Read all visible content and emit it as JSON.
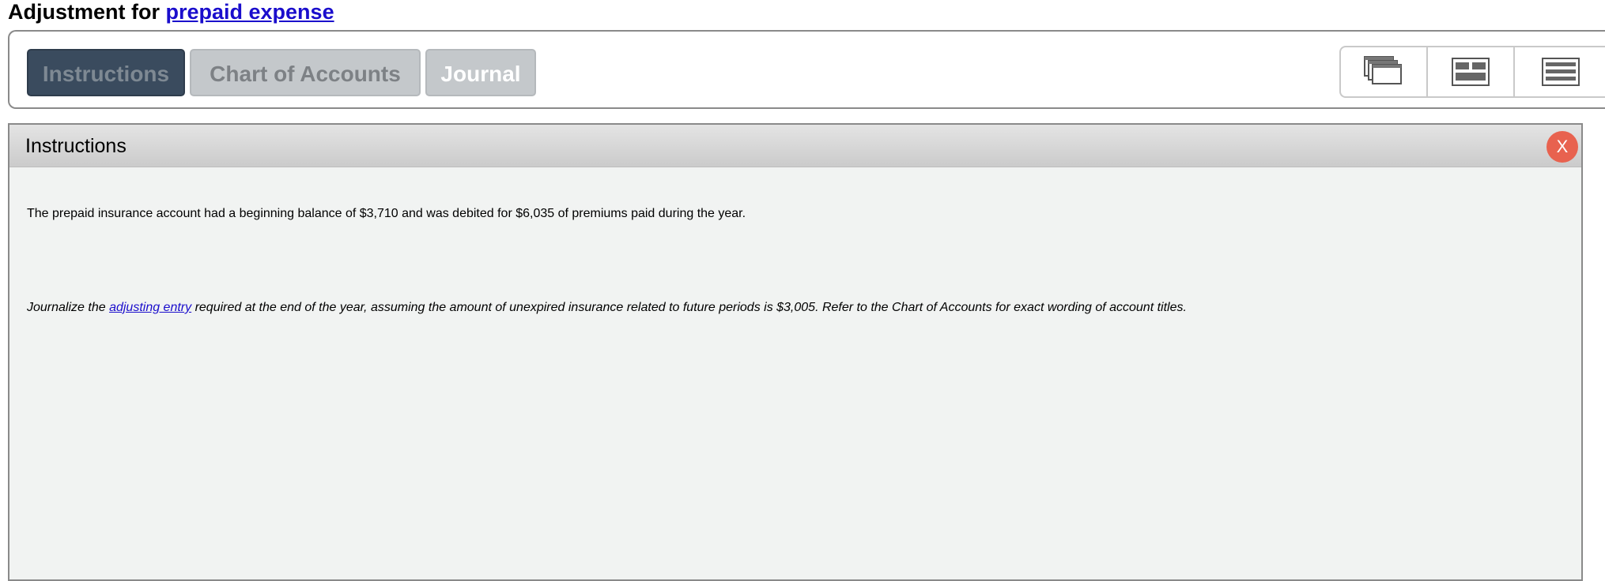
{
  "title": {
    "prefix": "Adjustment for ",
    "link": "prepaid expense"
  },
  "tabs": [
    {
      "label": "Instructions",
      "state": "active"
    },
    {
      "label": "Chart of Accounts",
      "state": "inactive"
    },
    {
      "label": "Journal",
      "state": "inactive"
    }
  ],
  "view_buttons": [
    {
      "icon": "cascade-windows-icon"
    },
    {
      "icon": "split-view-icon"
    },
    {
      "icon": "list-view-icon"
    }
  ],
  "panel": {
    "title": "Instructions",
    "close_label": "X",
    "paragraph1": "The prepaid insurance account had a beginning balance of $3,710 and was debited for $6,035 of premiums paid during the year.",
    "paragraph2": {
      "part1": "Journalize the ",
      "link": "adjusting entry",
      "part2": " required at the end of the year, assuming the amount of unexpired insurance related to future periods is $3,005. Refer to the Chart of Accounts for exact wording of account titles."
    }
  },
  "colors": {
    "active_tab_bg": "#3a4b5e",
    "inactive_tab_bg": "#c4c8cb",
    "link": "#1a0dcc",
    "close_button": "#e8624f",
    "panel_bg": "#f1f3f2"
  }
}
